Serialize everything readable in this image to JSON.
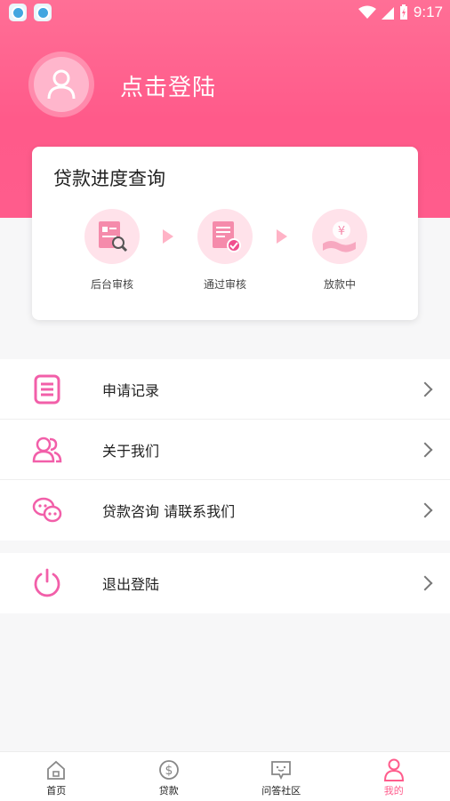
{
  "status_bar": {
    "time": "9:17",
    "apps": [
      "app-notification-icon",
      "app-notification-icon"
    ]
  },
  "profile": {
    "login_label": "点击登陆"
  },
  "progress": {
    "title": "贷款进度查询",
    "steps": [
      {
        "label": "后台审核",
        "icon": "review-document-icon"
      },
      {
        "label": "通过审核",
        "icon": "approved-document-icon"
      },
      {
        "label": "放款中",
        "icon": "money-hand-icon"
      }
    ]
  },
  "menu": {
    "items": [
      {
        "label": "申请记录",
        "icon": "list-icon"
      },
      {
        "label": "关于我们",
        "icon": "users-icon"
      },
      {
        "label": "贷款咨询 请联系我们",
        "icon": "chat-icon"
      }
    ],
    "logout": {
      "label": "退出登陆",
      "icon": "power-icon"
    }
  },
  "nav": {
    "items": [
      {
        "label": "首页",
        "icon": "home-icon"
      },
      {
        "label": "贷款",
        "icon": "dollar-icon"
      },
      {
        "label": "问答社区",
        "icon": "comment-icon"
      },
      {
        "label": "我的",
        "icon": "person-icon"
      }
    ],
    "active_index": 3
  },
  "colors": {
    "accent": "#ff5c8c",
    "icon_pink": "#f25fa9"
  }
}
